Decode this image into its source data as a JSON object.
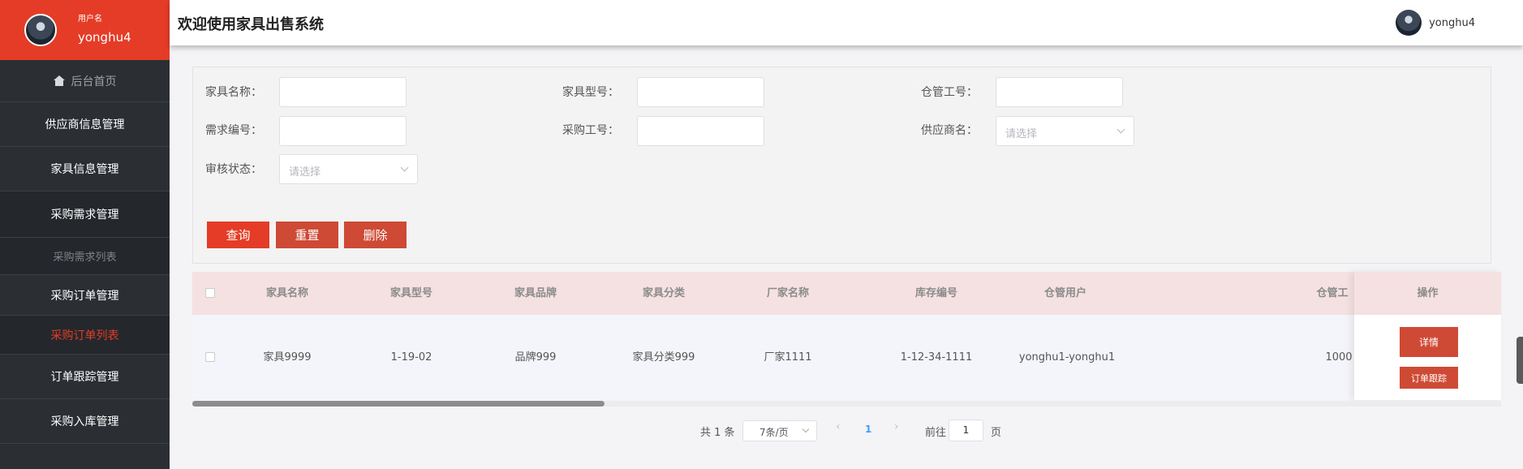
{
  "sidebar": {
    "user_label": "用户名",
    "user_name": "yonghu4",
    "home": "后台首页",
    "items": [
      "供应商信息管理",
      "家具信息管理",
      "采购需求管理",
      "采购需求列表",
      "采购订单管理",
      "采购订单列表",
      "订单跟踪管理",
      "采购入库管理"
    ]
  },
  "header": {
    "title": "欢迎使用家具出售系统",
    "username": "yonghu4"
  },
  "search": {
    "furniture_name_label": "家具名称：",
    "furniture_model_label": "家具型号：",
    "warehouse_no_label": "仓管工号：",
    "demand_no_label": "需求编号：",
    "purchase_no_label": "采购工号：",
    "supplier_label": "供应商名：",
    "supplier_placeholder": "请选择",
    "audit_label": "审核状态：",
    "audit_placeholder": "请选择",
    "query_btn": "查询",
    "reset_btn": "重置",
    "delete_btn": "删除"
  },
  "table": {
    "columns": [
      "家具名称",
      "家具型号",
      "家具品牌",
      "家具分类",
      "厂家名称",
      "库存编号",
      "仓管用户",
      "仓管工"
    ],
    "op_column": "操作",
    "rows": [
      [
        "家具9999",
        "1-19-02",
        "品牌999",
        "家具分类999",
        "厂家1111",
        "1-12-34-1111",
        "yonghu1-yonghu1",
        "1000"
      ]
    ],
    "detail_btn": "详情",
    "track_btn": "订单跟踪"
  },
  "pagination": {
    "total": "共 1 条",
    "page_size": "7条/页",
    "prev": "‹",
    "current": "1",
    "next": "›",
    "goto_label": "前往",
    "goto_value": "1",
    "page_suffix": "页"
  }
}
